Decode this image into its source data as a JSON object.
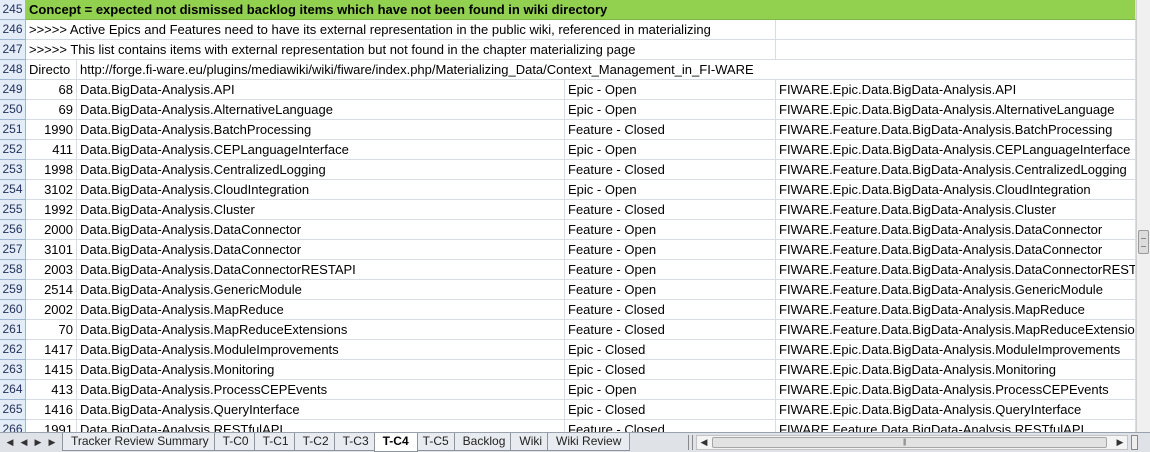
{
  "rows": [
    {
      "num": "245",
      "kind": "banner",
      "text": "Concept = expected not dismissed backlog items which have not been found in wiki directory"
    },
    {
      "num": "246",
      "kind": "note",
      "text": ">>>>> Active Epics and Features need to have its external representation in the public wiki, referenced in materializing"
    },
    {
      "num": "247",
      "kind": "note",
      "text": ">>>>> This list contains items with external representation but not found in the chapter materializing page"
    },
    {
      "num": "248",
      "kind": "dir",
      "a": "Directo",
      "b": "http://forge.fi-ware.eu/plugins/mediawiki/wiki/fiware/index.php/Materializing_Data/Context_Management_in_FI-WARE"
    },
    {
      "num": "249",
      "kind": "data",
      "a": "68",
      "b": "Data.BigData-Analysis.API",
      "c": "Epic - Open",
      "d": "FIWARE.Epic.Data.BigData-Analysis.API"
    },
    {
      "num": "250",
      "kind": "data",
      "a": "69",
      "b": "Data.BigData-Analysis.AlternativeLanguage",
      "c": "Epic - Open",
      "d": "FIWARE.Epic.Data.BigData-Analysis.AlternativeLanguage"
    },
    {
      "num": "251",
      "kind": "data",
      "a": "1990",
      "b": "Data.BigData-Analysis.BatchProcessing",
      "c": "Feature - Closed",
      "d": "FIWARE.Feature.Data.BigData-Analysis.BatchProcessing"
    },
    {
      "num": "252",
      "kind": "data",
      "a": "411",
      "b": "Data.BigData-Analysis.CEPLanguageInterface",
      "c": "Epic - Open",
      "d": "FIWARE.Epic.Data.BigData-Analysis.CEPLanguageInterface"
    },
    {
      "num": "253",
      "kind": "data",
      "a": "1998",
      "b": "Data.BigData-Analysis.CentralizedLogging",
      "c": "Feature - Closed",
      "d": "FIWARE.Feature.Data.BigData-Analysis.CentralizedLogging"
    },
    {
      "num": "254",
      "kind": "data",
      "a": "3102",
      "b": "Data.BigData-Analysis.CloudIntegration",
      "c": "Epic - Open",
      "d": "FIWARE.Epic.Data.BigData-Analysis.CloudIntegration"
    },
    {
      "num": "255",
      "kind": "data",
      "a": "1992",
      "b": "Data.BigData-Analysis.Cluster",
      "c": "Feature - Closed",
      "d": "FIWARE.Feature.Data.BigData-Analysis.Cluster"
    },
    {
      "num": "256",
      "kind": "data",
      "a": "2000",
      "b": "Data.BigData-Analysis.DataConnector",
      "c": "Feature - Open",
      "d": "FIWARE.Feature.Data.BigData-Analysis.DataConnector"
    },
    {
      "num": "257",
      "kind": "data",
      "a": "3101",
      "b": "Data.BigData-Analysis.DataConnector",
      "c": "Feature - Open",
      "d": "FIWARE.Feature.Data.BigData-Analysis.DataConnector"
    },
    {
      "num": "258",
      "kind": "data",
      "a": "2003",
      "b": "Data.BigData-Analysis.DataConnectorRESTAPI",
      "c": "Feature - Open",
      "d": "FIWARE.Feature.Data.BigData-Analysis.DataConnectorRESTAPI"
    },
    {
      "num": "259",
      "kind": "data",
      "a": "2514",
      "b": "Data.BigData-Analysis.GenericModule",
      "c": "Feature - Open",
      "d": "FIWARE.Feature.Data.BigData-Analysis.GenericModule"
    },
    {
      "num": "260",
      "kind": "data",
      "a": "2002",
      "b": "Data.BigData-Analysis.MapReduce",
      "c": "Feature - Closed",
      "d": "FIWARE.Feature.Data.BigData-Analysis.MapReduce"
    },
    {
      "num": "261",
      "kind": "data",
      "a": "70",
      "b": "Data.BigData-Analysis.MapReduceExtensions",
      "c": "Feature - Closed",
      "d": "FIWARE.Feature.Data.BigData-Analysis.MapReduceExtensions"
    },
    {
      "num": "262",
      "kind": "data",
      "a": "1417",
      "b": "Data.BigData-Analysis.ModuleImprovements",
      "c": "Epic - Closed",
      "d": "FIWARE.Epic.Data.BigData-Analysis.ModuleImprovements"
    },
    {
      "num": "263",
      "kind": "data",
      "a": "1415",
      "b": "Data.BigData-Analysis.Monitoring",
      "c": "Epic - Closed",
      "d": "FIWARE.Epic.Data.BigData-Analysis.Monitoring"
    },
    {
      "num": "264",
      "kind": "data",
      "a": "413",
      "b": "Data.BigData-Analysis.ProcessCEPEvents",
      "c": "Epic - Open",
      "d": "FIWARE.Epic.Data.BigData-Analysis.ProcessCEPEvents"
    },
    {
      "num": "265",
      "kind": "data",
      "a": "1416",
      "b": "Data.BigData-Analysis.QueryInterface",
      "c": "Epic - Closed",
      "d": "FIWARE.Epic.Data.BigData-Analysis.QueryInterface"
    },
    {
      "num": "266",
      "kind": "data",
      "a": "1991",
      "b": "Data.BigData-Analysis.RESTfulAPI",
      "c": "Feature - Closed",
      "d": "FIWARE.Feature.Data.BigData-Analysis.RESTfulAPI"
    }
  ],
  "tabs": [
    {
      "label": "Tracker Review Summary",
      "active": false
    },
    {
      "label": "T-C0",
      "active": false
    },
    {
      "label": "T-C1",
      "active": false
    },
    {
      "label": "T-C2",
      "active": false
    },
    {
      "label": "T-C3",
      "active": false
    },
    {
      "label": "T-C4",
      "active": true
    },
    {
      "label": "T-C5",
      "active": false
    },
    {
      "label": "Backlog",
      "active": false
    },
    {
      "label": "Wiki",
      "active": false
    },
    {
      "label": "Wiki Review",
      "active": false
    }
  ],
  "nav_icons": [
    "first-sheet-icon",
    "prev-sheet-icon",
    "next-sheet-icon",
    "last-sheet-icon"
  ],
  "colors": {
    "banner": "#92d050",
    "row_header": "#e4ecf7",
    "gridline": "#d8dde3"
  }
}
